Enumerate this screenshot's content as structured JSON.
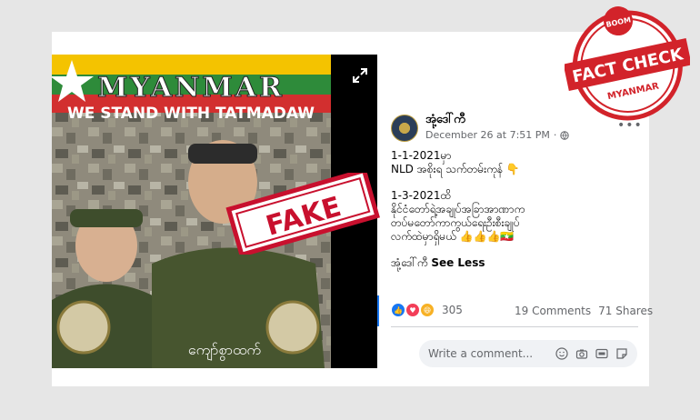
{
  "image": {
    "banner_title": "MYANMAR",
    "banner_subtitle": "WE STAND WITH TATMADAW",
    "caption": "ကျော်စွာထက်",
    "stamp_text": "FAKE"
  },
  "post": {
    "author": "အုံ့ဒေါ်ကီ",
    "timestamp": "December 26 at 7:51 PM",
    "separator": "·",
    "lines": [
      "1-1-2021မှာ",
      "NLD အစိုးရ သက်တမ်းကုန် 👇",
      "",
      "1-3-2021ထိ",
      "နိုင်ငံတော်ရဲ့အချုပ်အခြာအာဏာက",
      "တပ်မတော်ကာကွယ်ရေးဦးစီးချုပ်",
      "လက်ထဲမှာရှိမယ် 👍👍👍🇲🇲",
      ""
    ],
    "closing_text": "အုံ့ဒေါ်ကီ",
    "see_less": "See Less",
    "reaction_count": "305",
    "comments": "19 Comments",
    "shares": "71 Shares",
    "comment_placeholder": "Write a comment..."
  },
  "badge": {
    "top": "BOOM",
    "main": "FACT CHECK",
    "bottom": "MYANMAR"
  },
  "colors": {
    "accent_blue": "#1877f2",
    "badge_red": "#d2232a",
    "fake_red": "#c8102e"
  },
  "icons": [
    "expand-icon",
    "globe-icon",
    "more-icon",
    "like-icon",
    "love-icon",
    "haha-icon",
    "emoji-icon",
    "camera-icon",
    "gif-icon",
    "sticker-icon"
  ]
}
